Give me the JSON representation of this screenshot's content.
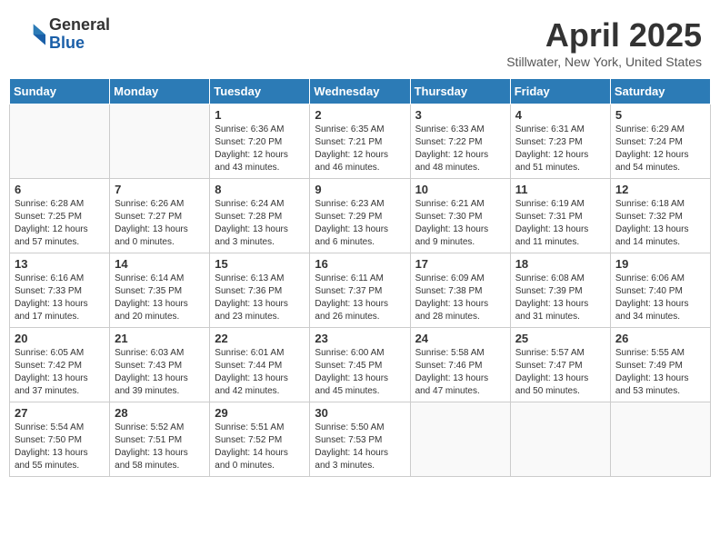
{
  "logo": {
    "general": "General",
    "blue": "Blue"
  },
  "header": {
    "month": "April 2025",
    "location": "Stillwater, New York, United States"
  },
  "weekdays": [
    "Sunday",
    "Monday",
    "Tuesday",
    "Wednesday",
    "Thursday",
    "Friday",
    "Saturday"
  ],
  "weeks": [
    [
      {
        "day": "",
        "detail": ""
      },
      {
        "day": "",
        "detail": ""
      },
      {
        "day": "1",
        "detail": "Sunrise: 6:36 AM\nSunset: 7:20 PM\nDaylight: 12 hours and 43 minutes."
      },
      {
        "day": "2",
        "detail": "Sunrise: 6:35 AM\nSunset: 7:21 PM\nDaylight: 12 hours and 46 minutes."
      },
      {
        "day": "3",
        "detail": "Sunrise: 6:33 AM\nSunset: 7:22 PM\nDaylight: 12 hours and 48 minutes."
      },
      {
        "day": "4",
        "detail": "Sunrise: 6:31 AM\nSunset: 7:23 PM\nDaylight: 12 hours and 51 minutes."
      },
      {
        "day": "5",
        "detail": "Sunrise: 6:29 AM\nSunset: 7:24 PM\nDaylight: 12 hours and 54 minutes."
      }
    ],
    [
      {
        "day": "6",
        "detail": "Sunrise: 6:28 AM\nSunset: 7:25 PM\nDaylight: 12 hours and 57 minutes."
      },
      {
        "day": "7",
        "detail": "Sunrise: 6:26 AM\nSunset: 7:27 PM\nDaylight: 13 hours and 0 minutes."
      },
      {
        "day": "8",
        "detail": "Sunrise: 6:24 AM\nSunset: 7:28 PM\nDaylight: 13 hours and 3 minutes."
      },
      {
        "day": "9",
        "detail": "Sunrise: 6:23 AM\nSunset: 7:29 PM\nDaylight: 13 hours and 6 minutes."
      },
      {
        "day": "10",
        "detail": "Sunrise: 6:21 AM\nSunset: 7:30 PM\nDaylight: 13 hours and 9 minutes."
      },
      {
        "day": "11",
        "detail": "Sunrise: 6:19 AM\nSunset: 7:31 PM\nDaylight: 13 hours and 11 minutes."
      },
      {
        "day": "12",
        "detail": "Sunrise: 6:18 AM\nSunset: 7:32 PM\nDaylight: 13 hours and 14 minutes."
      }
    ],
    [
      {
        "day": "13",
        "detail": "Sunrise: 6:16 AM\nSunset: 7:33 PM\nDaylight: 13 hours and 17 minutes."
      },
      {
        "day": "14",
        "detail": "Sunrise: 6:14 AM\nSunset: 7:35 PM\nDaylight: 13 hours and 20 minutes."
      },
      {
        "day": "15",
        "detail": "Sunrise: 6:13 AM\nSunset: 7:36 PM\nDaylight: 13 hours and 23 minutes."
      },
      {
        "day": "16",
        "detail": "Sunrise: 6:11 AM\nSunset: 7:37 PM\nDaylight: 13 hours and 26 minutes."
      },
      {
        "day": "17",
        "detail": "Sunrise: 6:09 AM\nSunset: 7:38 PM\nDaylight: 13 hours and 28 minutes."
      },
      {
        "day": "18",
        "detail": "Sunrise: 6:08 AM\nSunset: 7:39 PM\nDaylight: 13 hours and 31 minutes."
      },
      {
        "day": "19",
        "detail": "Sunrise: 6:06 AM\nSunset: 7:40 PM\nDaylight: 13 hours and 34 minutes."
      }
    ],
    [
      {
        "day": "20",
        "detail": "Sunrise: 6:05 AM\nSunset: 7:42 PM\nDaylight: 13 hours and 37 minutes."
      },
      {
        "day": "21",
        "detail": "Sunrise: 6:03 AM\nSunset: 7:43 PM\nDaylight: 13 hours and 39 minutes."
      },
      {
        "day": "22",
        "detail": "Sunrise: 6:01 AM\nSunset: 7:44 PM\nDaylight: 13 hours and 42 minutes."
      },
      {
        "day": "23",
        "detail": "Sunrise: 6:00 AM\nSunset: 7:45 PM\nDaylight: 13 hours and 45 minutes."
      },
      {
        "day": "24",
        "detail": "Sunrise: 5:58 AM\nSunset: 7:46 PM\nDaylight: 13 hours and 47 minutes."
      },
      {
        "day": "25",
        "detail": "Sunrise: 5:57 AM\nSunset: 7:47 PM\nDaylight: 13 hours and 50 minutes."
      },
      {
        "day": "26",
        "detail": "Sunrise: 5:55 AM\nSunset: 7:49 PM\nDaylight: 13 hours and 53 minutes."
      }
    ],
    [
      {
        "day": "27",
        "detail": "Sunrise: 5:54 AM\nSunset: 7:50 PM\nDaylight: 13 hours and 55 minutes."
      },
      {
        "day": "28",
        "detail": "Sunrise: 5:52 AM\nSunset: 7:51 PM\nDaylight: 13 hours and 58 minutes."
      },
      {
        "day": "29",
        "detail": "Sunrise: 5:51 AM\nSunset: 7:52 PM\nDaylight: 14 hours and 0 minutes."
      },
      {
        "day": "30",
        "detail": "Sunrise: 5:50 AM\nSunset: 7:53 PM\nDaylight: 14 hours and 3 minutes."
      },
      {
        "day": "",
        "detail": ""
      },
      {
        "day": "",
        "detail": ""
      },
      {
        "day": "",
        "detail": ""
      }
    ]
  ]
}
